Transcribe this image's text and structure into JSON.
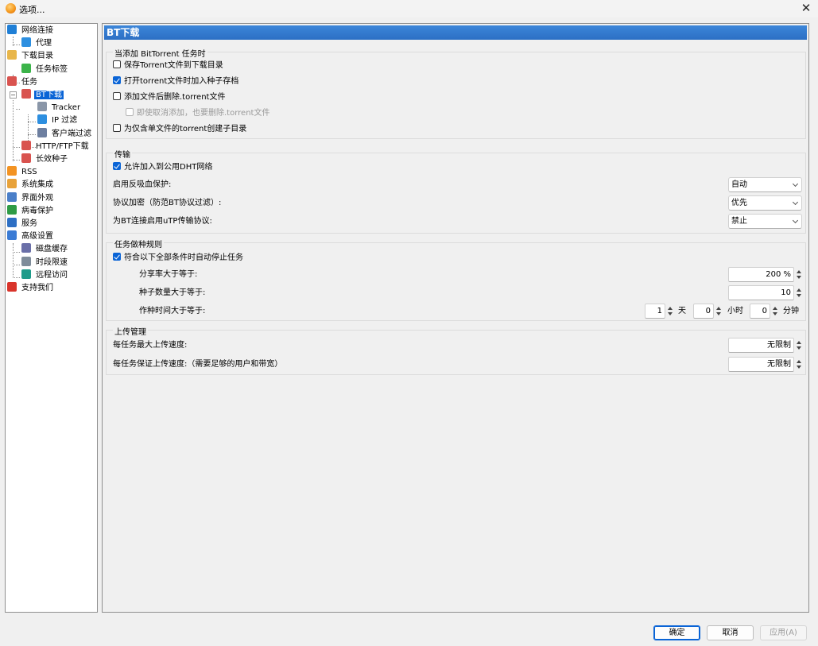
{
  "window": {
    "title": "选项...",
    "close_glyph": "✕"
  },
  "tree": {
    "items": [
      {
        "label": "网络连接",
        "icon": "network-icon",
        "color": "#1f7fd6"
      },
      {
        "label": "代理",
        "icon": "proxy-icon",
        "color": "#2d8fe0"
      },
      {
        "label": "下载目录",
        "icon": "folder-icon",
        "color": "#e8b64a"
      },
      {
        "label": "任务标签",
        "icon": "tag-icon",
        "color": "#3cb44a"
      },
      {
        "label": "任务",
        "icon": "task-icon",
        "color": "#d9534f"
      },
      {
        "label": "BT下载",
        "icon": "bt-icon",
        "color": "#d9534f"
      },
      {
        "label": "Tracker",
        "icon": "tracker-icon",
        "color": "#8a96a8"
      },
      {
        "label": "IP 过滤",
        "icon": "ip-filter-icon",
        "color": "#2d8fe0"
      },
      {
        "label": "客户端过滤",
        "icon": "client-filter-icon",
        "color": "#6d7fa0"
      },
      {
        "label": "HTTP/FTP下载",
        "icon": "http-icon",
        "color": "#d9534f"
      },
      {
        "label": "长效种子",
        "icon": "seed-icon",
        "color": "#d9534f"
      },
      {
        "label": "RSS",
        "icon": "rss-icon",
        "color": "#f39322"
      },
      {
        "label": "系统集成",
        "icon": "integration-icon",
        "color": "#e8a23a"
      },
      {
        "label": "界面外观",
        "icon": "appearance-icon",
        "color": "#4a7fc9"
      },
      {
        "label": "病毒保护",
        "icon": "shield-icon",
        "color": "#2e9b45"
      },
      {
        "label": "服务",
        "icon": "service-icon",
        "color": "#2d6fc4"
      },
      {
        "label": "高级设置",
        "icon": "advanced-icon",
        "color": "#3a7bd5"
      },
      {
        "label": "磁盘缓存",
        "icon": "disk-icon",
        "color": "#6a6fa8"
      },
      {
        "label": "时段限速",
        "icon": "schedule-icon",
        "color": "#7f8c9a"
      },
      {
        "label": "远程访问",
        "icon": "remote-icon",
        "color": "#1f9b8a"
      },
      {
        "label": "支持我们",
        "icon": "heart-icon",
        "color": "#d9342b"
      }
    ]
  },
  "panel": {
    "header": "BT下载",
    "group_add": {
      "title": "当添加 BitTorrent 任务时",
      "save_torrent": {
        "label": "保存Torrent文件到下载目录",
        "checked": false
      },
      "add_to_archive": {
        "label": "打开torrent文件时加入种子存档",
        "checked": true
      },
      "delete_after_add": {
        "label": "添加文件后删除.torrent文件",
        "checked": false
      },
      "delete_even_cancel": {
        "label": "即使取消添加，也要删除.torrent文件",
        "checked": false
      },
      "create_subdir": {
        "label": "为仅含单文件的torrent创建子目录",
        "checked": false
      }
    },
    "group_transfer": {
      "title": "传输",
      "allow_dht": {
        "label": "允许加入到公用DHT网络",
        "checked": true
      },
      "anti_leech_label": "启用反吸血保护:",
      "anti_leech_value": "自动",
      "encryption_label": "协议加密（防范BT协议过滤）:",
      "encryption_value": "优先",
      "utp_label": "为BT连接启用uTP传输协议:",
      "utp_value": "禁止"
    },
    "group_seeding": {
      "title": "任务做种规则",
      "auto_stop": {
        "label": "符合以下全部条件时自动停止任务",
        "checked": true
      },
      "ratio_label": "分享率大于等于:",
      "ratio_value": "200 %",
      "seeds_label": "种子数量大于等于:",
      "seeds_value": "10",
      "time_label": "作种时间大于等于:",
      "days_value": "1",
      "days_unit": "天",
      "hours_value": "0",
      "hours_unit": "小时",
      "minutes_value": "0",
      "minutes_unit": "分钟"
    },
    "group_upload": {
      "title": "上传管理",
      "max_upload_label": "每任务最大上传速度:",
      "max_upload_value": "无限制",
      "guaranteed_upload_label": "每任务保证上传速度:（需要足够的用户和带宽）",
      "guaranteed_upload_value": "无限制"
    }
  },
  "buttons": {
    "ok": "确定",
    "cancel": "取消",
    "apply": "应用(A)"
  }
}
